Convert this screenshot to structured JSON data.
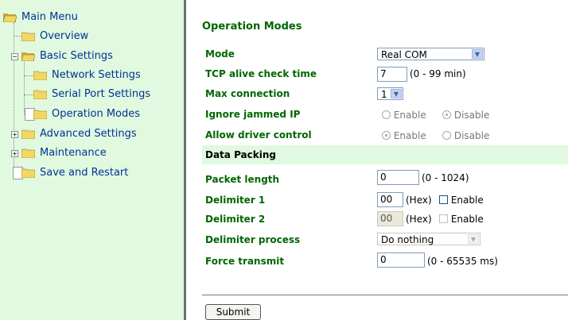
{
  "sidebar": {
    "items": [
      {
        "label": "Main Menu"
      },
      {
        "label": "Overview"
      },
      {
        "label": "Basic Settings"
      },
      {
        "label": "Network Settings"
      },
      {
        "label": "Serial Port Settings"
      },
      {
        "label": "Operation Modes"
      },
      {
        "label": "Advanced Settings"
      },
      {
        "label": "Maintenance"
      },
      {
        "label": "Save and Restart"
      }
    ]
  },
  "main": {
    "title": "Operation Modes",
    "mode": {
      "label": "Mode",
      "value": "Real COM"
    },
    "tcp_alive": {
      "label": "TCP alive check time",
      "value": "7",
      "hint": "(0 - 99 min)"
    },
    "max_connection": {
      "label": "Max connection",
      "value": "1"
    },
    "ignore_jammed": {
      "label": "Ignore jammed IP",
      "enable": "Enable",
      "disable": "Disable"
    },
    "allow_driver": {
      "label": "Allow driver control",
      "enable": "Enable",
      "disable": "Disable"
    },
    "data_packing": {
      "title": "Data Packing"
    },
    "packet_length": {
      "label": "Packet length",
      "value": "0",
      "hint": "(0 - 1024)"
    },
    "delimiter1": {
      "label": "Delimiter 1",
      "value": "00",
      "unit": "(Hex)",
      "enable": "Enable"
    },
    "delimiter2": {
      "label": "Delimiter 2",
      "value": "00",
      "unit": "(Hex)",
      "enable": "Enable"
    },
    "delimiter_process": {
      "label": "Delimiter process",
      "value": "Do nothing"
    },
    "force_transmit": {
      "label": "Force transmit",
      "value": "0",
      "hint": "(0 - 65535 ms)"
    },
    "submit_label": "Submit"
  },
  "colors": {
    "sidebar_bg": "#e1f9de",
    "label_green": "#006600",
    "link_blue": "#003399",
    "folder_yellow": "#f2d765"
  }
}
